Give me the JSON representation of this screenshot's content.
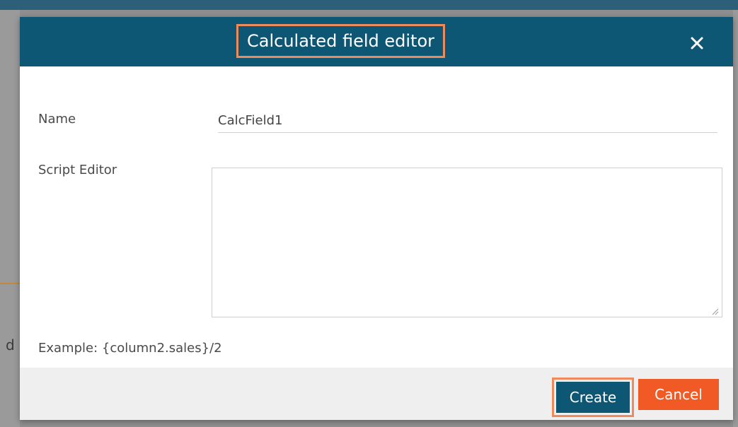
{
  "dialog": {
    "title": "Calculated field editor",
    "close_icon": "close-icon"
  },
  "background": {
    "partial_text": "d"
  },
  "form": {
    "name_label": "Name",
    "name_value": "CalcField1",
    "script_label": "Script Editor",
    "script_value": "",
    "example_text": "Example: {column2.sales}/2"
  },
  "footer": {
    "create_label": "Create",
    "cancel_label": "Cancel"
  },
  "colors": {
    "header": "#0d5674",
    "create_button": "#0d5674",
    "cancel_button": "#f15a24",
    "highlight": "#ef8a5c"
  }
}
